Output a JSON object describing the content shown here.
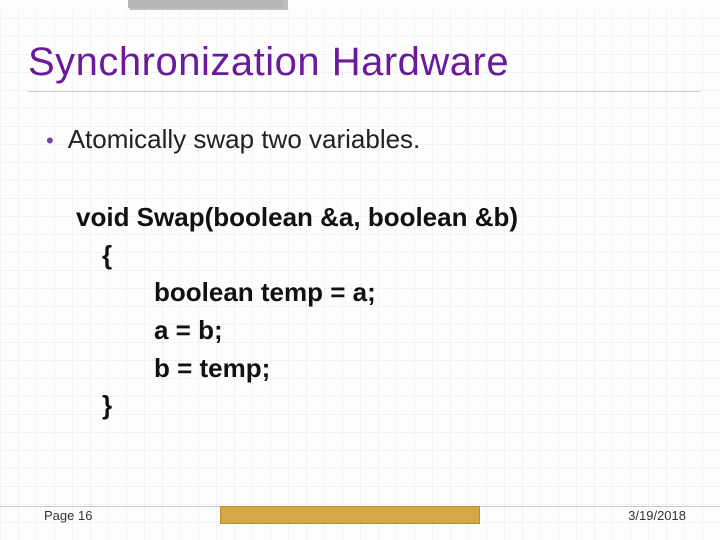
{
  "title": "Synchronization Hardware",
  "bullet": "Atomically swap two variables.",
  "code": {
    "sig": "void Swap(boolean &a, boolean &b)",
    "open": "{",
    "l1": "boolean temp = a;",
    "l2": "a = b;",
    "l3": "b = temp;",
    "close": "}"
  },
  "footer": {
    "page": "Page 16",
    "date": "3/19/2018"
  }
}
